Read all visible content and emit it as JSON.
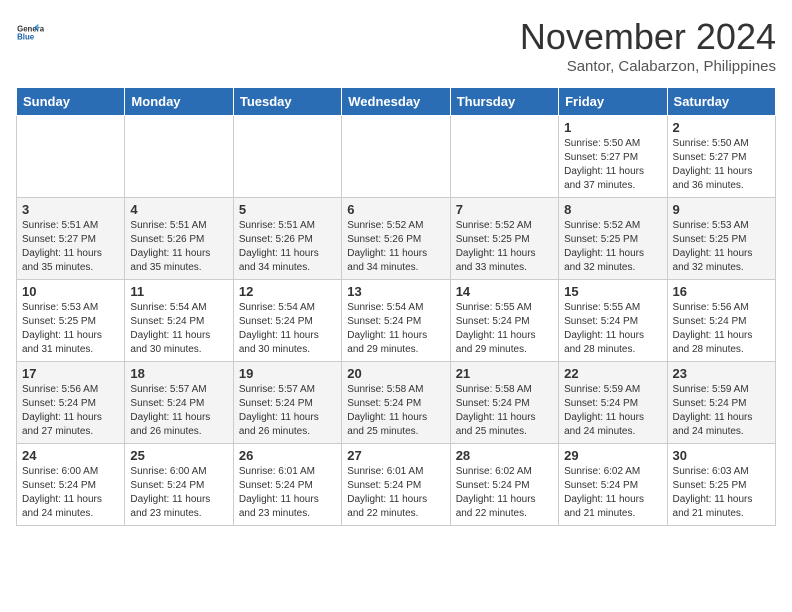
{
  "header": {
    "logo_general": "General",
    "logo_blue": "Blue",
    "month_title": "November 2024",
    "location": "Santor, Calabarzon, Philippines"
  },
  "weekdays": [
    "Sunday",
    "Monday",
    "Tuesday",
    "Wednesday",
    "Thursday",
    "Friday",
    "Saturday"
  ],
  "weeks": [
    [
      {
        "day": "",
        "info": ""
      },
      {
        "day": "",
        "info": ""
      },
      {
        "day": "",
        "info": ""
      },
      {
        "day": "",
        "info": ""
      },
      {
        "day": "",
        "info": ""
      },
      {
        "day": "1",
        "info": "Sunrise: 5:50 AM\nSunset: 5:27 PM\nDaylight: 11 hours\nand 37 minutes."
      },
      {
        "day": "2",
        "info": "Sunrise: 5:50 AM\nSunset: 5:27 PM\nDaylight: 11 hours\nand 36 minutes."
      }
    ],
    [
      {
        "day": "3",
        "info": "Sunrise: 5:51 AM\nSunset: 5:27 PM\nDaylight: 11 hours\nand 35 minutes."
      },
      {
        "day": "4",
        "info": "Sunrise: 5:51 AM\nSunset: 5:26 PM\nDaylight: 11 hours\nand 35 minutes."
      },
      {
        "day": "5",
        "info": "Sunrise: 5:51 AM\nSunset: 5:26 PM\nDaylight: 11 hours\nand 34 minutes."
      },
      {
        "day": "6",
        "info": "Sunrise: 5:52 AM\nSunset: 5:26 PM\nDaylight: 11 hours\nand 34 minutes."
      },
      {
        "day": "7",
        "info": "Sunrise: 5:52 AM\nSunset: 5:25 PM\nDaylight: 11 hours\nand 33 minutes."
      },
      {
        "day": "8",
        "info": "Sunrise: 5:52 AM\nSunset: 5:25 PM\nDaylight: 11 hours\nand 32 minutes."
      },
      {
        "day": "9",
        "info": "Sunrise: 5:53 AM\nSunset: 5:25 PM\nDaylight: 11 hours\nand 32 minutes."
      }
    ],
    [
      {
        "day": "10",
        "info": "Sunrise: 5:53 AM\nSunset: 5:25 PM\nDaylight: 11 hours\nand 31 minutes."
      },
      {
        "day": "11",
        "info": "Sunrise: 5:54 AM\nSunset: 5:24 PM\nDaylight: 11 hours\nand 30 minutes."
      },
      {
        "day": "12",
        "info": "Sunrise: 5:54 AM\nSunset: 5:24 PM\nDaylight: 11 hours\nand 30 minutes."
      },
      {
        "day": "13",
        "info": "Sunrise: 5:54 AM\nSunset: 5:24 PM\nDaylight: 11 hours\nand 29 minutes."
      },
      {
        "day": "14",
        "info": "Sunrise: 5:55 AM\nSunset: 5:24 PM\nDaylight: 11 hours\nand 29 minutes."
      },
      {
        "day": "15",
        "info": "Sunrise: 5:55 AM\nSunset: 5:24 PM\nDaylight: 11 hours\nand 28 minutes."
      },
      {
        "day": "16",
        "info": "Sunrise: 5:56 AM\nSunset: 5:24 PM\nDaylight: 11 hours\nand 28 minutes."
      }
    ],
    [
      {
        "day": "17",
        "info": "Sunrise: 5:56 AM\nSunset: 5:24 PM\nDaylight: 11 hours\nand 27 minutes."
      },
      {
        "day": "18",
        "info": "Sunrise: 5:57 AM\nSunset: 5:24 PM\nDaylight: 11 hours\nand 26 minutes."
      },
      {
        "day": "19",
        "info": "Sunrise: 5:57 AM\nSunset: 5:24 PM\nDaylight: 11 hours\nand 26 minutes."
      },
      {
        "day": "20",
        "info": "Sunrise: 5:58 AM\nSunset: 5:24 PM\nDaylight: 11 hours\nand 25 minutes."
      },
      {
        "day": "21",
        "info": "Sunrise: 5:58 AM\nSunset: 5:24 PM\nDaylight: 11 hours\nand 25 minutes."
      },
      {
        "day": "22",
        "info": "Sunrise: 5:59 AM\nSunset: 5:24 PM\nDaylight: 11 hours\nand 24 minutes."
      },
      {
        "day": "23",
        "info": "Sunrise: 5:59 AM\nSunset: 5:24 PM\nDaylight: 11 hours\nand 24 minutes."
      }
    ],
    [
      {
        "day": "24",
        "info": "Sunrise: 6:00 AM\nSunset: 5:24 PM\nDaylight: 11 hours\nand 24 minutes."
      },
      {
        "day": "25",
        "info": "Sunrise: 6:00 AM\nSunset: 5:24 PM\nDaylight: 11 hours\nand 23 minutes."
      },
      {
        "day": "26",
        "info": "Sunrise: 6:01 AM\nSunset: 5:24 PM\nDaylight: 11 hours\nand 23 minutes."
      },
      {
        "day": "27",
        "info": "Sunrise: 6:01 AM\nSunset: 5:24 PM\nDaylight: 11 hours\nand 22 minutes."
      },
      {
        "day": "28",
        "info": "Sunrise: 6:02 AM\nSunset: 5:24 PM\nDaylight: 11 hours\nand 22 minutes."
      },
      {
        "day": "29",
        "info": "Sunrise: 6:02 AM\nSunset: 5:24 PM\nDaylight: 11 hours\nand 21 minutes."
      },
      {
        "day": "30",
        "info": "Sunrise: 6:03 AM\nSunset: 5:25 PM\nDaylight: 11 hours\nand 21 minutes."
      }
    ]
  ]
}
